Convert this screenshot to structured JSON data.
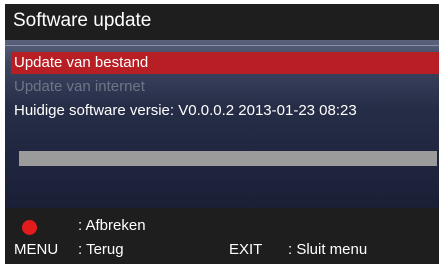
{
  "title": "Software update",
  "menu": {
    "items": [
      {
        "label": "Update van bestand",
        "state": "selected"
      },
      {
        "label": "Update van internet",
        "state": "disabled"
      }
    ],
    "software_version_line": "Huidige software versie: V0.0.0.2 2013-01-23 08:23"
  },
  "progress": {
    "fraction": 0
  },
  "footer": {
    "red_key_icon": "red-button-icon",
    "abort_label": ": Afbreken",
    "menu_key": "MENU",
    "back_label": ": Terug",
    "exit_key": "EXIT",
    "close_menu_label": ": Sluit menu"
  },
  "colors": {
    "title_bar": "#1e1e1e",
    "selected_item": "#b81f24",
    "disabled_text": "#6f7488",
    "red_key": "#e31b1b",
    "progress_track": "#9b9b9b"
  }
}
